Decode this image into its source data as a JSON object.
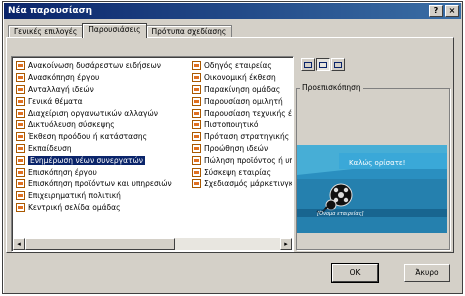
{
  "window": {
    "title": "Νέα παρουσίαση",
    "help_btn": "?",
    "close_btn": "×"
  },
  "tabs": [
    {
      "label": "Γενικές επιλογές"
    },
    {
      "label": "Παρουσιάσεις",
      "active": true
    },
    {
      "label": "Πρότυπα σχεδίασης"
    }
  ],
  "list": {
    "column1": [
      "Ανακοίνωση δυσάρεστων ειδήσεων",
      "Ανασκόπηση έργου",
      "Ανταλλαγή ιδεών",
      "Γενικά θέματα",
      "Διαχείριση οργανωτικών αλλαγών",
      "Δικτυόλευση σύσκεψης",
      "Έκθεση προόδου ή κατάστασης",
      "Εκπαίδευση",
      "Ενημέρωση νέων συνεργατών",
      "Επισκόπηση έργου",
      "Επισκόπηση προϊόντων και υπηρεσιών",
      "Επιχειρηματική πολιτική",
      "Κεντρική σελίδα ομάδας"
    ],
    "column2": [
      "Οδηγός εταιρείας",
      "Οικονομική έκθεση",
      "Παρακίνηση ομάδας",
      "Παρουσίαση ομιλητή",
      "Παρουσίαση τεχνικής έκθε",
      "Πιστοποιητικό",
      "Πρόταση στρατηγικής",
      "Προώθηση ιδεών",
      "Πώληση προϊόντος ή υπηρ",
      "Σύσκεψη εταιρίας",
      "Σχεδιασμός μάρκετινγκ"
    ],
    "selected": "Ενημέρωση νέων συνεργατών"
  },
  "scrollbar": {
    "left_arrow": "◂",
    "right_arrow": "▸"
  },
  "preview": {
    "label": "Προεπισκόπηση",
    "slide_title": "Καλώς ορίσατε!",
    "slide_subtitle": "[Όνομα εταιρείας]",
    "colors": {
      "background": "#2a8fc0",
      "accent": "#5fc8e8",
      "panel": "#1e6e9a"
    }
  },
  "view_buttons": [
    {
      "icon": "large-icons-view-icon"
    },
    {
      "icon": "list-view-icon",
      "pressed": true
    },
    {
      "icon": "details-view-icon"
    }
  ],
  "buttons": {
    "ok": "OK",
    "cancel": "Άκυρο"
  }
}
